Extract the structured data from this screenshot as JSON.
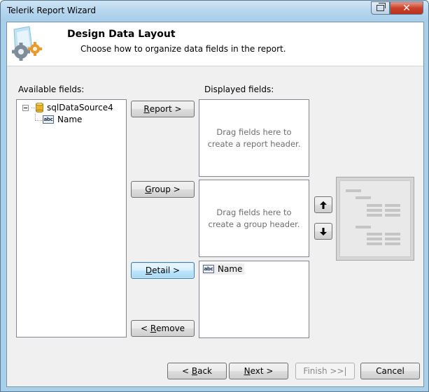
{
  "window": {
    "title": "Telerik Report Wizard"
  },
  "header": {
    "title": "Design Data Layout",
    "subtitle": "Choose how to organize data fields in the report."
  },
  "available": {
    "label": "Available fields:",
    "tree": [
      {
        "label": "sqlDataSource4",
        "icon": "database-icon",
        "expanded": true
      },
      {
        "label": "Name",
        "icon": "abc-field-icon"
      }
    ]
  },
  "displayed": {
    "label": "Displayed fields:",
    "report_placeholder": "Drag fields here to create a report header.",
    "group_placeholder": "Drag fields here to create a group header.",
    "detail_items": [
      "Name"
    ]
  },
  "buttons": {
    "report": {
      "mnemonic": "R",
      "rest": "eport >"
    },
    "group": {
      "mnemonic": "G",
      "rest": "roup >"
    },
    "detail": {
      "mnemonic": "D",
      "rest": "etail >"
    },
    "remove": {
      "pre": "< ",
      "mnemonic": "R",
      "rest": "emove"
    },
    "back": {
      "pre": "< ",
      "mnemonic": "B",
      "rest": "ack"
    },
    "next": {
      "mnemonic": "N",
      "rest": "ext >"
    },
    "finish": "Finish >>|",
    "cancel": "Cancel"
  },
  "icons": {
    "move_up": "arrow-up-icon",
    "move_down": "arrow-down-icon"
  },
  "colors": {
    "titlebar": "#b5d6ee",
    "close": "#c9432c",
    "focus": "#3c7fb1"
  }
}
